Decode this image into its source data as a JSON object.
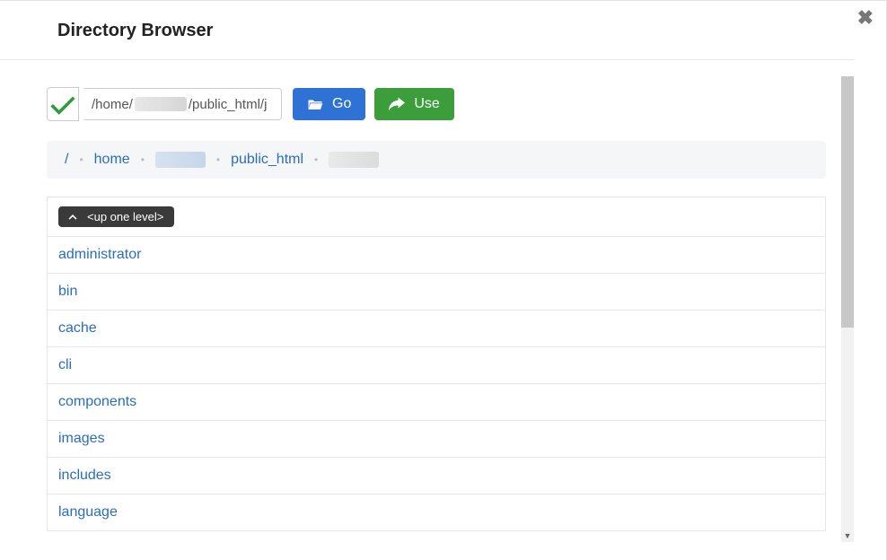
{
  "modal": {
    "title": "Directory Browser"
  },
  "path": {
    "value_prefix": "/home/",
    "value_suffix": "/public_html/j",
    "go_label": "Go",
    "use_label": "Use"
  },
  "crumbs": {
    "root": "/",
    "home": "home",
    "public_html": "public_html"
  },
  "list": {
    "up_label": "<up one level>",
    "items": [
      "administrator",
      "bin",
      "cache",
      "cli",
      "components",
      "images",
      "includes",
      "language"
    ]
  }
}
